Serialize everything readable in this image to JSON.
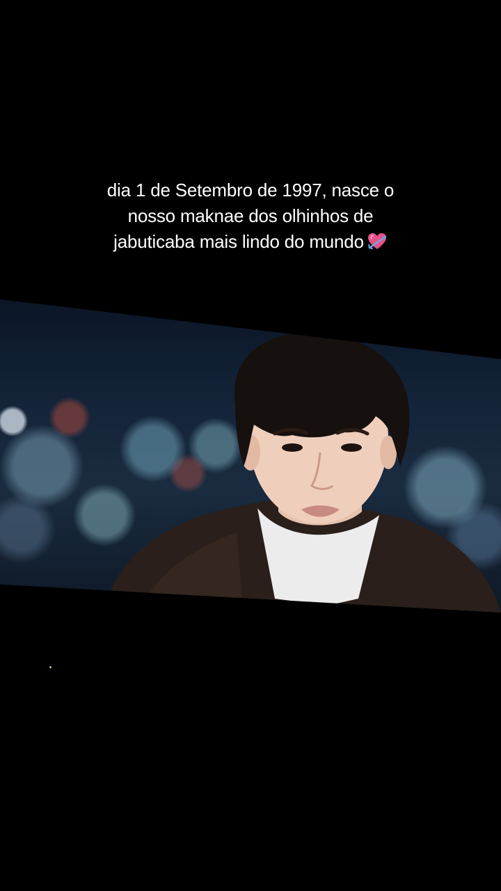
{
  "caption": {
    "line1": "dia 1 de Setembro de 1997, nasce o",
    "line2": "nosso maknae dos olhinhos de",
    "line3": "jabuticaba mais lindo do mundo",
    "emoji_icon": "heart-with-arrow-icon"
  },
  "colors": {
    "background": "#000000",
    "caption_text": "#ffffff",
    "heart": "#e8508a"
  }
}
